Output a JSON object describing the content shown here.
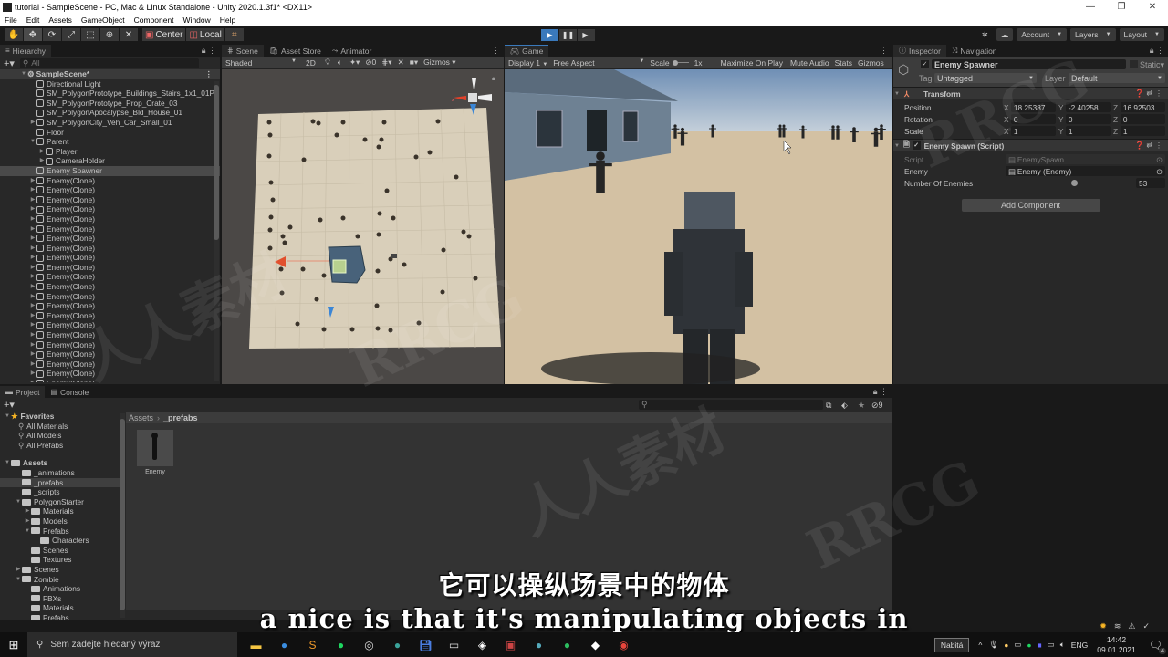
{
  "window": {
    "title": "tutorial - SampleScene - PC, Mac & Linux Standalone - Unity 2020.1.3f1* <DX11>",
    "controls": [
      "—",
      "❐",
      "✕"
    ]
  },
  "menu": [
    "File",
    "Edit",
    "Assets",
    "GameObject",
    "Component",
    "Window",
    "Help"
  ],
  "toolbar": {
    "pivot": "Center",
    "space": "Local",
    "account": "Account",
    "layers": "Layers",
    "layout": "Layout"
  },
  "hierarchy": {
    "tab": "Hierarchy",
    "search_placeholder": "All",
    "scene": "SampleScene*",
    "items": [
      {
        "label": "Directional Light",
        "depth": 1,
        "expand": ""
      },
      {
        "label": "SM_PolygonPrototype_Buildings_Stairs_1x1_01P",
        "depth": 1,
        "expand": ""
      },
      {
        "label": "SM_PolygonPrototype_Prop_Crate_03",
        "depth": 1,
        "expand": ""
      },
      {
        "label": "SM_PolygonApocalypse_Bld_House_01",
        "depth": 1,
        "expand": ""
      },
      {
        "label": "SM_PolygonCity_Veh_Car_Small_01",
        "depth": 1,
        "expand": "▶"
      },
      {
        "label": "Floor",
        "depth": 1,
        "expand": ""
      },
      {
        "label": "Parent",
        "depth": 1,
        "expand": "▼"
      },
      {
        "label": "Player",
        "depth": 2,
        "expand": "▶"
      },
      {
        "label": "CameraHolder",
        "depth": 2,
        "expand": "▶"
      },
      {
        "label": "Enemy Spawner",
        "depth": 1,
        "expand": "",
        "selected": true
      },
      {
        "label": "Enemy(Clone)",
        "depth": 1,
        "expand": "▶"
      },
      {
        "label": "Enemy(Clone)",
        "depth": 1,
        "expand": "▶"
      },
      {
        "label": "Enemy(Clone)",
        "depth": 1,
        "expand": "▶"
      },
      {
        "label": "Enemy(Clone)",
        "depth": 1,
        "expand": "▶"
      },
      {
        "label": "Enemy(Clone)",
        "depth": 1,
        "expand": "▶"
      },
      {
        "label": "Enemy(Clone)",
        "depth": 1,
        "expand": "▶"
      },
      {
        "label": "Enemy(Clone)",
        "depth": 1,
        "expand": "▶"
      },
      {
        "label": "Enemy(Clone)",
        "depth": 1,
        "expand": "▶"
      },
      {
        "label": "Enemy(Clone)",
        "depth": 1,
        "expand": "▶"
      },
      {
        "label": "Enemy(Clone)",
        "depth": 1,
        "expand": "▶"
      },
      {
        "label": "Enemy(Clone)",
        "depth": 1,
        "expand": "▶"
      },
      {
        "label": "Enemy(Clone)",
        "depth": 1,
        "expand": "▶"
      },
      {
        "label": "Enemy(Clone)",
        "depth": 1,
        "expand": "▶"
      },
      {
        "label": "Enemy(Clone)",
        "depth": 1,
        "expand": "▶"
      },
      {
        "label": "Enemy(Clone)",
        "depth": 1,
        "expand": "▶"
      },
      {
        "label": "Enemy(Clone)",
        "depth": 1,
        "expand": "▶"
      },
      {
        "label": "Enemy(Clone)",
        "depth": 1,
        "expand": "▶"
      },
      {
        "label": "Enemy(Clone)",
        "depth": 1,
        "expand": "▶"
      },
      {
        "label": "Enemy(Clone)",
        "depth": 1,
        "expand": "▶"
      },
      {
        "label": "Enemy(Clone)",
        "depth": 1,
        "expand": "▶"
      },
      {
        "label": "Enemy(Clone)",
        "depth": 1,
        "expand": "▶"
      },
      {
        "label": "Enemy(Clone)",
        "depth": 1,
        "expand": "▶"
      }
    ]
  },
  "scene_view": {
    "tabs": [
      "Scene",
      "Asset Store",
      "Animator"
    ],
    "shading": "Shaded",
    "mode_2d": "2D",
    "hidden_count": "0",
    "gizmos": "Gizmos"
  },
  "game_view": {
    "tab": "Game",
    "display": "Display 1",
    "aspect": "Free Aspect",
    "scale_label": "Scale",
    "scale_value": "1x",
    "buttons": [
      "Maximize On Play",
      "Mute Audio",
      "Stats",
      "Gizmos"
    ]
  },
  "inspector": {
    "tabs": [
      "Inspector",
      "Navigation"
    ],
    "object_name": "Enemy Spawner",
    "static_label": "Static",
    "tag_label": "Tag",
    "tag_value": "Untagged",
    "layer_label": "Layer",
    "layer_value": "Default",
    "transform": {
      "title": "Transform",
      "rows": [
        {
          "label": "Position",
          "x": "18.25387",
          "y": "-2.40258",
          "z": "16.92503"
        },
        {
          "label": "Rotation",
          "x": "0",
          "y": "0",
          "z": "0"
        },
        {
          "label": "Scale",
          "x": "1",
          "y": "1",
          "z": "1"
        }
      ]
    },
    "script": {
      "title": "Enemy Spawn (Script)",
      "script_label": "Script",
      "script_value": "EnemySpawn",
      "enemy_label": "Enemy",
      "enemy_value": "Enemy (Enemy)",
      "count_label": "Number Of Enemies",
      "count_value": "53",
      "slider_fraction": 0.55
    },
    "add_component": "Add Component"
  },
  "project": {
    "tabs": [
      "Project",
      "Console"
    ],
    "hidden_count": "9",
    "favorites_label": "Favorites",
    "favorites": [
      "All Materials",
      "All Models",
      "All Prefabs"
    ],
    "assets_label": "Assets",
    "folders": [
      {
        "label": "_animations",
        "depth": 1,
        "expand": ""
      },
      {
        "label": "_prefabs",
        "depth": 1,
        "expand": "",
        "selected": true
      },
      {
        "label": "_scripts",
        "depth": 1,
        "expand": ""
      },
      {
        "label": "PolygonStarter",
        "depth": 1,
        "expand": "▼"
      },
      {
        "label": "Materials",
        "depth": 2,
        "expand": "▶"
      },
      {
        "label": "Models",
        "depth": 2,
        "expand": "▶"
      },
      {
        "label": "Prefabs",
        "depth": 2,
        "expand": "▼"
      },
      {
        "label": "Characters",
        "depth": 3,
        "expand": ""
      },
      {
        "label": "Scenes",
        "depth": 2,
        "expand": ""
      },
      {
        "label": "Textures",
        "depth": 2,
        "expand": ""
      },
      {
        "label": "Scenes",
        "depth": 1,
        "expand": "▶"
      },
      {
        "label": "Zombie",
        "depth": 1,
        "expand": "▼"
      },
      {
        "label": "Animations",
        "depth": 2,
        "expand": ""
      },
      {
        "label": "FBXs",
        "depth": 2,
        "expand": ""
      },
      {
        "label": "Materials",
        "depth": 2,
        "expand": ""
      },
      {
        "label": "Prefabs",
        "depth": 2,
        "expand": ""
      }
    ],
    "breadcrumb": [
      "Assets",
      "_prefabs"
    ],
    "asset_items": [
      {
        "label": "Enemy"
      }
    ]
  },
  "subtitles": {
    "chinese": "它可以操纵场景中的物体",
    "english": "a nice is that it's manipulating objects in"
  },
  "taskbar": {
    "search_placeholder": "Sem zadejte hledaný výraz",
    "tooltip": "Nabitá",
    "language": "ENG",
    "time": "14:42",
    "date": "09.01.2021",
    "notifications": "4"
  },
  "watermarks": [
    "RRCG",
    "人人素材"
  ]
}
